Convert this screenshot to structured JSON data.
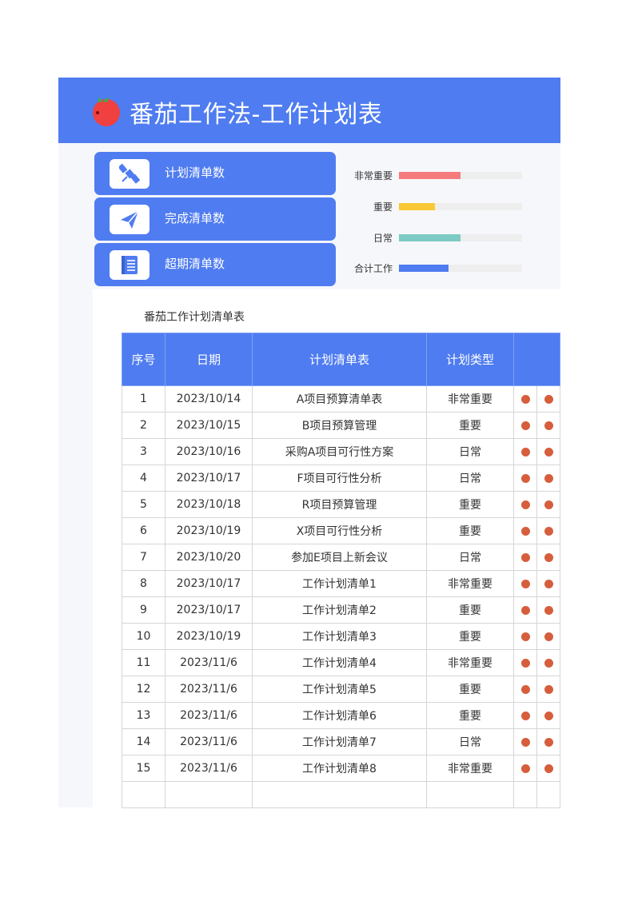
{
  "header": {
    "title": "番茄工作法-工作计划表"
  },
  "cards": [
    {
      "label": "计划清单数",
      "icon": "satellite-icon"
    },
    {
      "label": "完成清单数",
      "icon": "paper-plane-icon"
    },
    {
      "label": "超期清单数",
      "icon": "notebook-icon"
    }
  ],
  "bars": [
    {
      "label": "非常重要",
      "fraction": 0.5,
      "color": "#f47c7c"
    },
    {
      "label": "重要",
      "fraction": 0.29,
      "color": "#f9c935"
    },
    {
      "label": "日常",
      "fraction": 0.5,
      "color": "#7ecac4"
    },
    {
      "label": "合计工作",
      "fraction": 0.4,
      "color": "#4f7cf0"
    }
  ],
  "table": {
    "subtitle": "番茄工作计划清单表",
    "headers": [
      "序号",
      "日期",
      "计划清单表",
      "计划类型",
      ""
    ],
    "rows": [
      [
        "1",
        "2023/10/14",
        "A项目预算清单表",
        "非常重要"
      ],
      [
        "2",
        "2023/10/15",
        "B项目预算管理",
        "重要"
      ],
      [
        "3",
        "2023/10/16",
        "采购A项目可行性方案",
        "日常"
      ],
      [
        "4",
        "2023/10/17",
        "F项目可行性分析",
        "日常"
      ],
      [
        "5",
        "2023/10/18",
        "R项目预算管理",
        "重要"
      ],
      [
        "6",
        "2023/10/19",
        "X项目可行性分析",
        "重要"
      ],
      [
        "7",
        "2023/10/20",
        "参加E项目上新会议",
        "日常"
      ],
      [
        "8",
        "2023/10/17",
        "工作计划清单1",
        "非常重要"
      ],
      [
        "9",
        "2023/10/17",
        "工作计划清单2",
        "重要"
      ],
      [
        "10",
        "2023/10/19",
        "工作计划清单3",
        "重要"
      ],
      [
        "11",
        "2023/11/6",
        "工作计划清单4",
        "非常重要"
      ],
      [
        "12",
        "2023/11/6",
        "工作计划清单5",
        "重要"
      ],
      [
        "13",
        "2023/11/6",
        "工作计划清单6",
        "重要"
      ],
      [
        "14",
        "2023/11/6",
        "工作计划清单7",
        "日常"
      ],
      [
        "15",
        "2023/11/6",
        "工作计划清单8",
        "非常重要"
      ]
    ],
    "dot_color": "#d65e3c"
  }
}
